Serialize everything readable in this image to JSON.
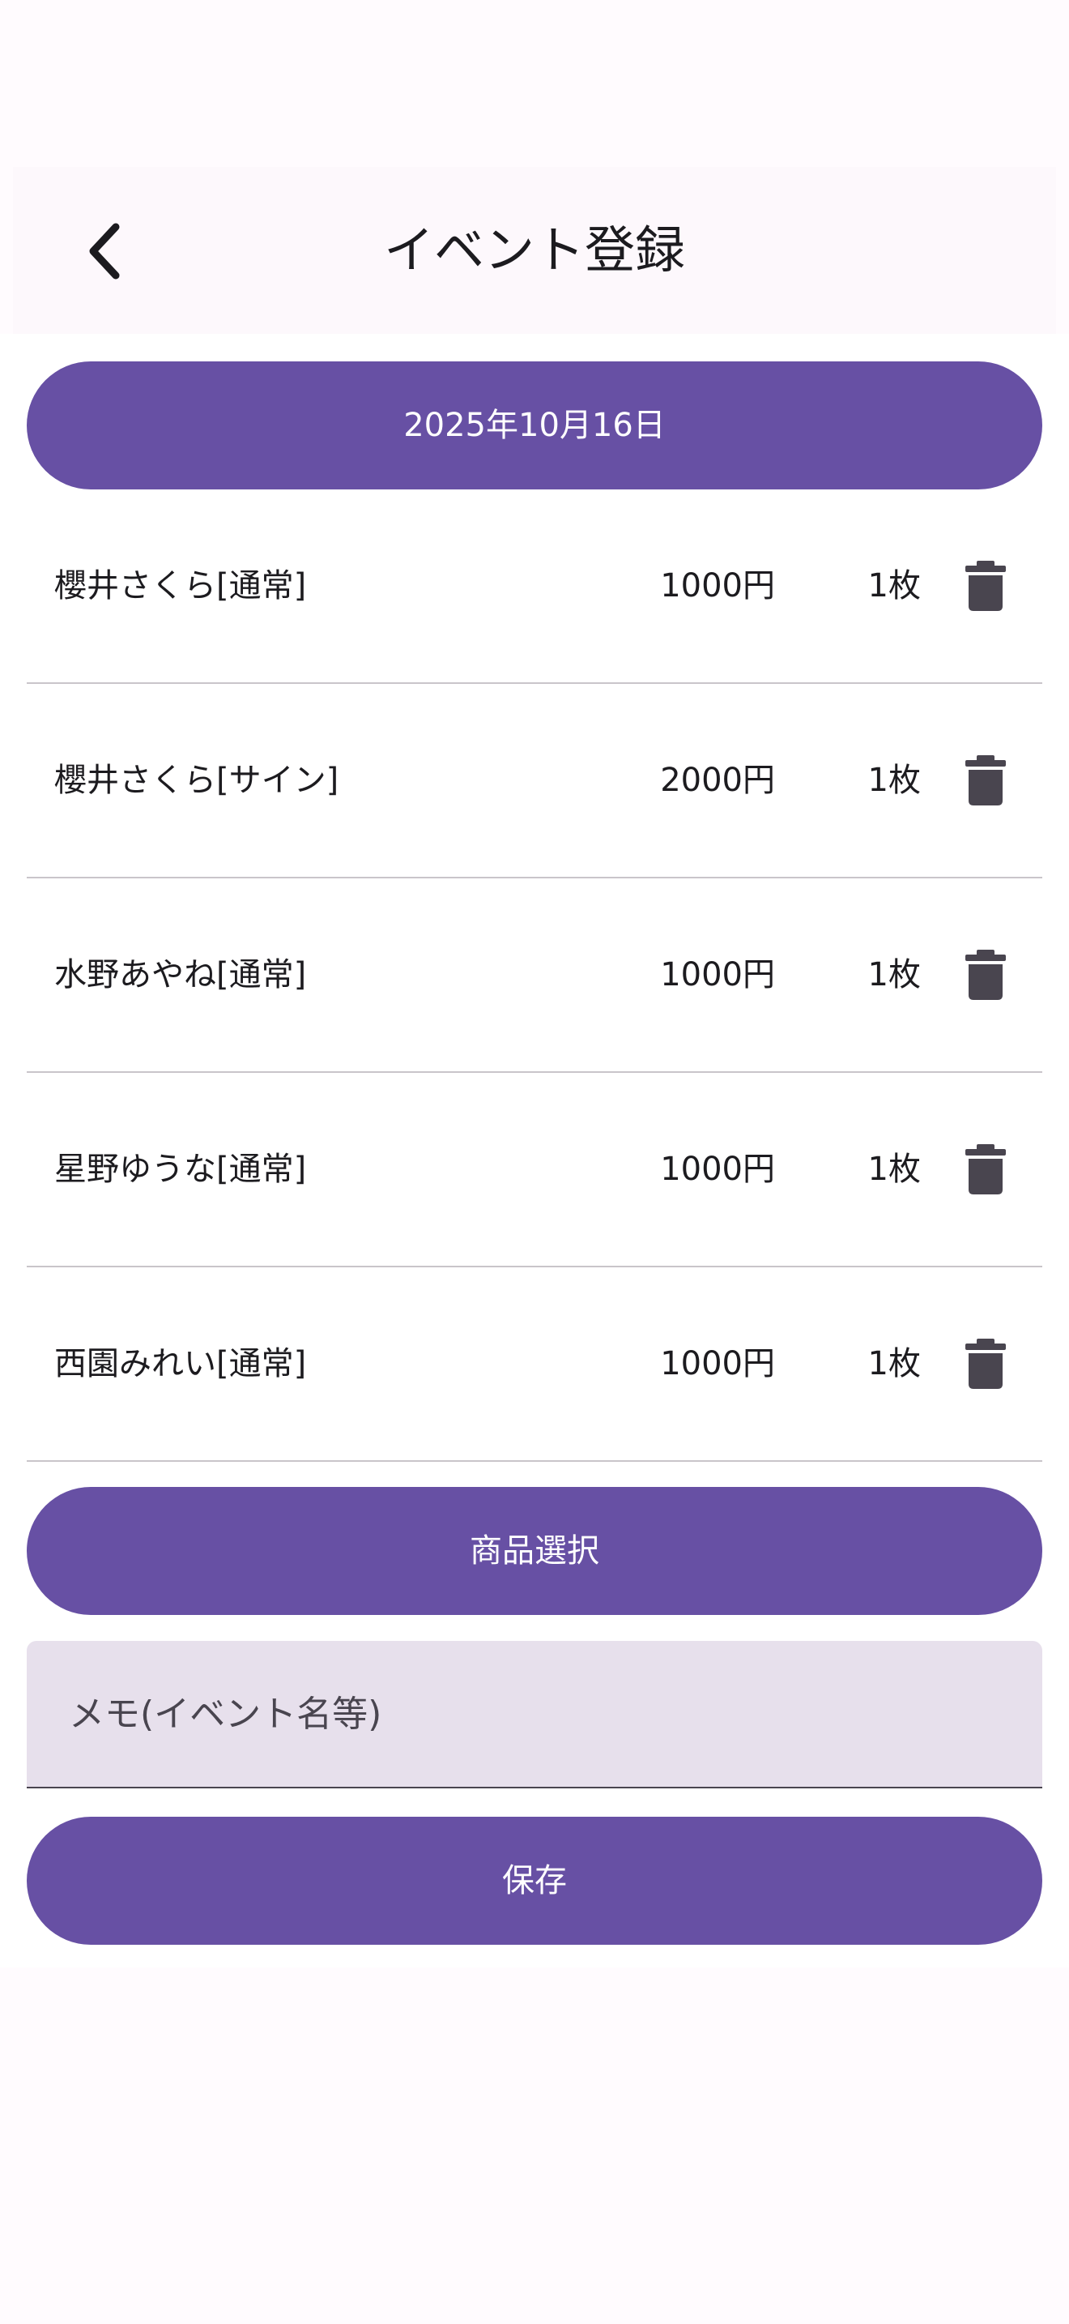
{
  "header": {
    "title": "イベント登録",
    "back_icon": "chevron-left-icon"
  },
  "date_button": {
    "label": "2025年10月16日"
  },
  "items": [
    {
      "name": "櫻井さくら[通常]",
      "price": "1000円",
      "quantity": "1枚"
    },
    {
      "name": "櫻井さくら[サイン]",
      "price": "2000円",
      "quantity": "1枚"
    },
    {
      "name": "水野あやね[通常]",
      "price": "1000円",
      "quantity": "1枚"
    },
    {
      "name": "星野ゆうな[通常]",
      "price": "1000円",
      "quantity": "1枚"
    },
    {
      "name": "西園みれい[通常]",
      "price": "1000円",
      "quantity": "1枚"
    }
  ],
  "delete_icon": "trash-icon",
  "product_select_button": {
    "label": "商品選択"
  },
  "memo": {
    "placeholder": "メモ(イベント名等)",
    "value": ""
  },
  "save_button": {
    "label": "保存"
  },
  "colors": {
    "primary": "#6750a4",
    "background": "#fffbfe",
    "field": "#e7e0ec",
    "divider": "#c9c5ca",
    "icon": "#49454f"
  }
}
